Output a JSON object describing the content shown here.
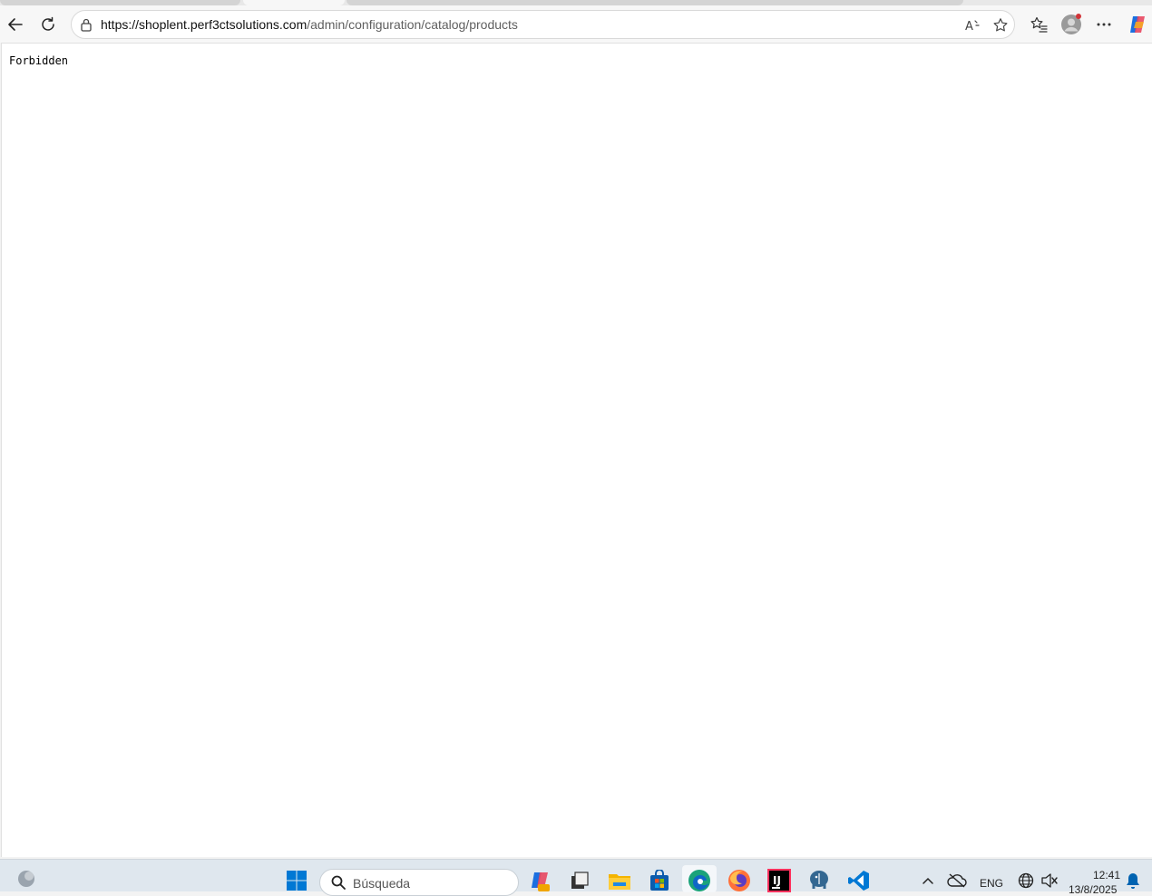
{
  "browser": {
    "url_host": "https://shoplent.perf3ctsolutions.com",
    "url_path": "/admin/configuration/catalog/products"
  },
  "page": {
    "message": "Forbidden"
  },
  "taskbar": {
    "search_placeholder": "Búsqueda",
    "language": "ENG",
    "time": "12:41",
    "date": "13/8/2025"
  },
  "colors": {
    "windows_blue": "#0078d4",
    "edge_teal": "#1aa37a",
    "notification_blue": "#0063b1"
  }
}
